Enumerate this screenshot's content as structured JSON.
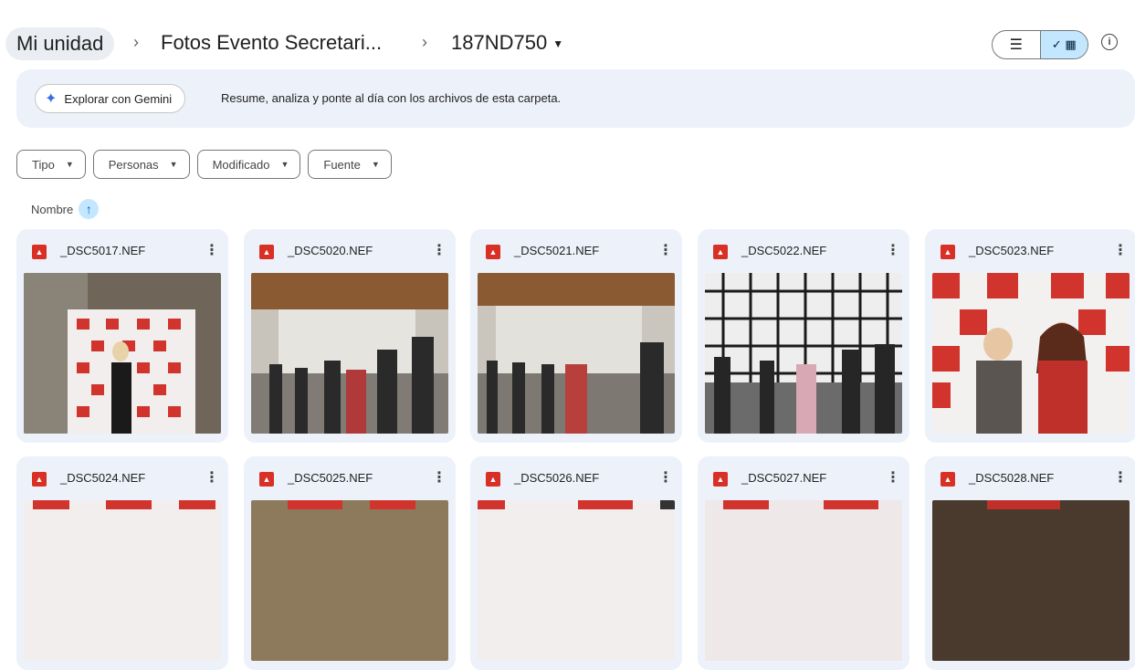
{
  "breadcrumb": {
    "root": "Mi unidad",
    "parent": "Fotos Evento Secretari...",
    "current": "187ND750"
  },
  "view": {
    "list_icon": "list-view-icon",
    "grid_icon": "grid-view-icon",
    "info_icon": "info-icon"
  },
  "gemini": {
    "button_label": "Explorar con Gemini",
    "description": "Resume, analiza y ponte al día con los archivos de esta carpeta."
  },
  "filters": [
    "Tipo",
    "Personas",
    "Modificado",
    "Fuente"
  ],
  "sort": {
    "label": "Nombre",
    "direction": "ascending"
  },
  "files": [
    {
      "name": "_DSC5017.NEF"
    },
    {
      "name": "_DSC5020.NEF"
    },
    {
      "name": "_DSC5021.NEF"
    },
    {
      "name": "_DSC5022.NEF"
    },
    {
      "name": "_DSC5023.NEF"
    },
    {
      "name": "_DSC5024.NEF"
    },
    {
      "name": "_DSC5025.NEF"
    },
    {
      "name": "_DSC5026.NEF"
    },
    {
      "name": "_DSC5027.NEF"
    },
    {
      "name": "_DSC5028.NEF"
    }
  ],
  "colors": {
    "accent": "#0b57d0",
    "selected": "#c2e7ff",
    "card_bg": "#edf2fa",
    "file_icon": "#d93025"
  }
}
